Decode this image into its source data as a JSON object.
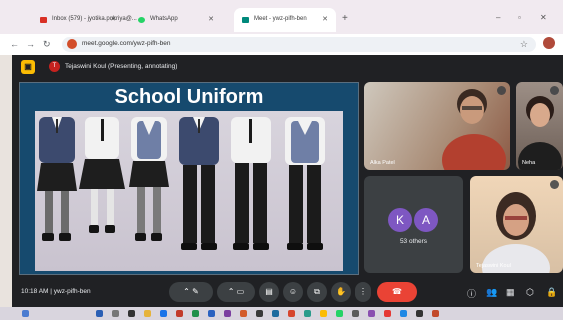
{
  "browser": {
    "tabs": [
      {
        "label": "Inbox (579) - jyotika.pukriya@...",
        "favicon_color": "#d93025"
      },
      {
        "label": "WhatsApp",
        "favicon_color": "#25d366"
      },
      {
        "label": "Meet - ywz-pifh-ben",
        "favicon_color": "#00897b",
        "active": true
      }
    ],
    "url": "meet.google.com/ywz-pifh-ben"
  },
  "meet": {
    "presenter_initial": "T",
    "presenter_text": "Tejaswini Koul (Presenting, annotating)",
    "slide_title": "School Uniform",
    "tiles": {
      "participant1_name": "Alka Patel",
      "participant2_name": "Neha",
      "others_initials": [
        "K",
        "A"
      ],
      "others_count": "53 others",
      "self_name": "Tejaswini Koul"
    },
    "time": "10:18 AM",
    "meeting_code": "ywz-pifh-ben"
  },
  "colors": {
    "accent": "#164a6e",
    "end_call": "#ea4335",
    "avatar": "#7e57c2"
  }
}
